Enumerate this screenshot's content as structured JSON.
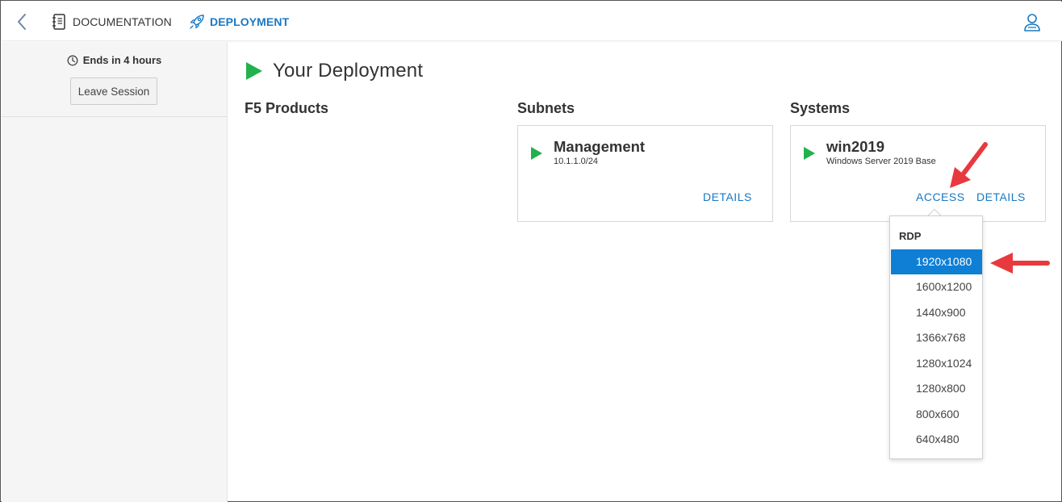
{
  "nav": {
    "documentation_label": "DOCUMENTATION",
    "deployment_label": "DEPLOYMENT",
    "active_color": "#1a78c2"
  },
  "sidebar": {
    "ends_text": "Ends in 4 hours",
    "leave_label": "Leave Session"
  },
  "main": {
    "title": "Your Deployment",
    "columns": {
      "products": "F5 Products",
      "subnets": "Subnets",
      "systems": "Systems"
    },
    "subnet_card": {
      "title": "Management",
      "subtitle": "10.1.1.0/24",
      "details_label": "DETAILS"
    },
    "system_card": {
      "title": "win2019",
      "subtitle": "Windows Server 2019 Base",
      "access_label": "ACCESS",
      "details_label": "DETAILS"
    }
  },
  "access_menu": {
    "header": "RDP",
    "selected_index": 0,
    "items": [
      "1920x1080",
      "1600x1200",
      "1440x900",
      "1366x768",
      "1280x1024",
      "1280x800",
      "800x600",
      "640x480"
    ],
    "selected_color": "#0f7fd6"
  },
  "colors": {
    "play_green": "#22b14c",
    "link_blue": "#1a78c2",
    "annotation_red": "#e8393f"
  }
}
